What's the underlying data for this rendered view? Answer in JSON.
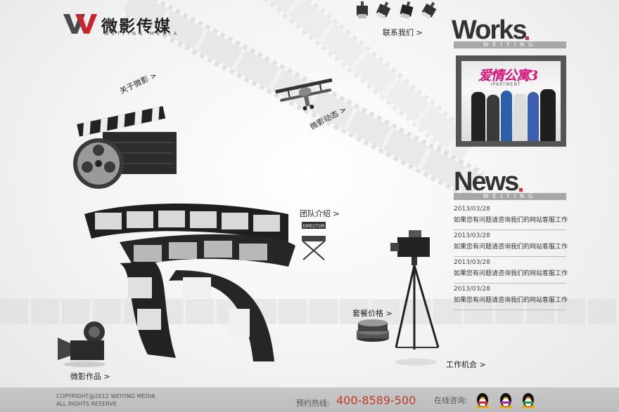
{
  "logo": {
    "text": "微影传媒",
    "subtitle": "WEIYING MEDIA"
  },
  "nav": {
    "contact": "联系我们 >",
    "about": "关于微影 >",
    "news": "微影动态 >",
    "team": "团队介绍 >",
    "packages": "套餐价格 >",
    "works": "微影作品 >",
    "jobs": "工作机会 >"
  },
  "works": {
    "title": "Works",
    "subtitle": "WEIYING",
    "poster_title": "爱情公寓3",
    "poster_subtitle": "IPARTMENT"
  },
  "news": {
    "title": "News",
    "subtitle": "WEIYING",
    "items": [
      {
        "date": "2013/03/28",
        "text": "如果您有问题请咨询我们的网站客服工作"
      },
      {
        "date": "2013/03/28",
        "text": "如果您有问题请咨询我们的网站客服工作"
      },
      {
        "date": "2013/03/28",
        "text": "如果您有问题请咨询我们的网站客服工作"
      },
      {
        "date": "2013/03/28",
        "text": "如果您有问题请咨询我们的网站客服工作"
      }
    ]
  },
  "footer": {
    "copyright_line1": "COPYRIGHT@2012 WEIYING MEDIA",
    "copyright_line2": "ALL RIGHTS RESERVE",
    "hotline_label": "预约热线:",
    "hotline": "400-8589-500",
    "online_label": "在线咨询:"
  },
  "icons": {
    "spotlights": [
      "spotlight-icon",
      "spotlight-icon",
      "spotlight-icon",
      "spotlight-icon"
    ],
    "qq": [
      "qq-penguin-icon",
      "qq-penguin-icon",
      "qq-penguin-icon"
    ],
    "director_chair_sign": "DIRECTOR"
  },
  "colors": {
    "accent_red": "#d3323e",
    "hotline_red": "#c0392b",
    "footer_gray": "#c2c2c2",
    "section_bar": "#a7a7a7"
  }
}
